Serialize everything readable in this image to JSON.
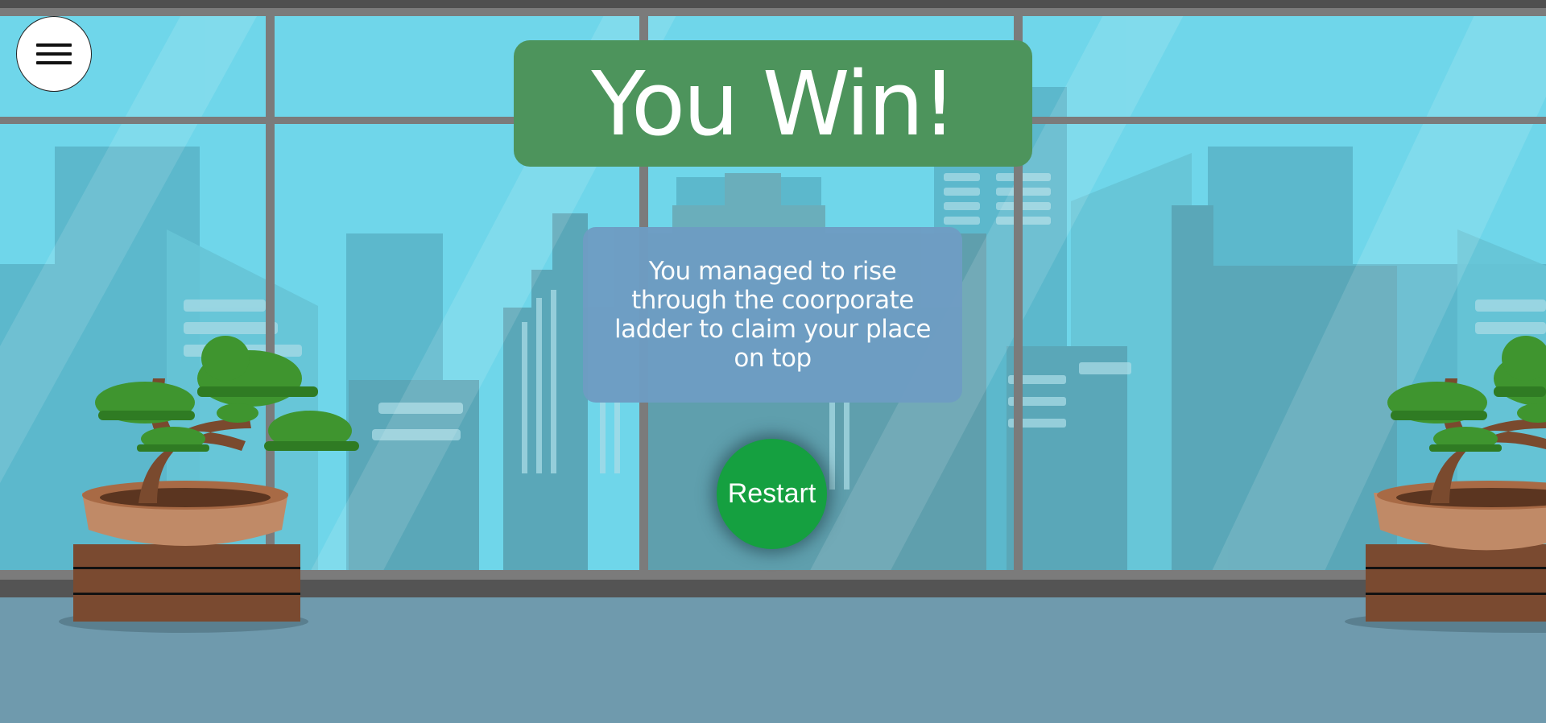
{
  "menu": {
    "icon": "hamburger-menu-icon"
  },
  "title": {
    "text": "You Win!"
  },
  "message": {
    "text": "You managed to rise through the coorporate ladder to claim your place on top"
  },
  "restart": {
    "label": "Restart"
  },
  "colors": {
    "title_banner": "#4d945c",
    "message_box": "#6e9dc3",
    "restart_button": "#15a040",
    "sky": "#6fd6ea",
    "floor": "#6f9aad"
  }
}
